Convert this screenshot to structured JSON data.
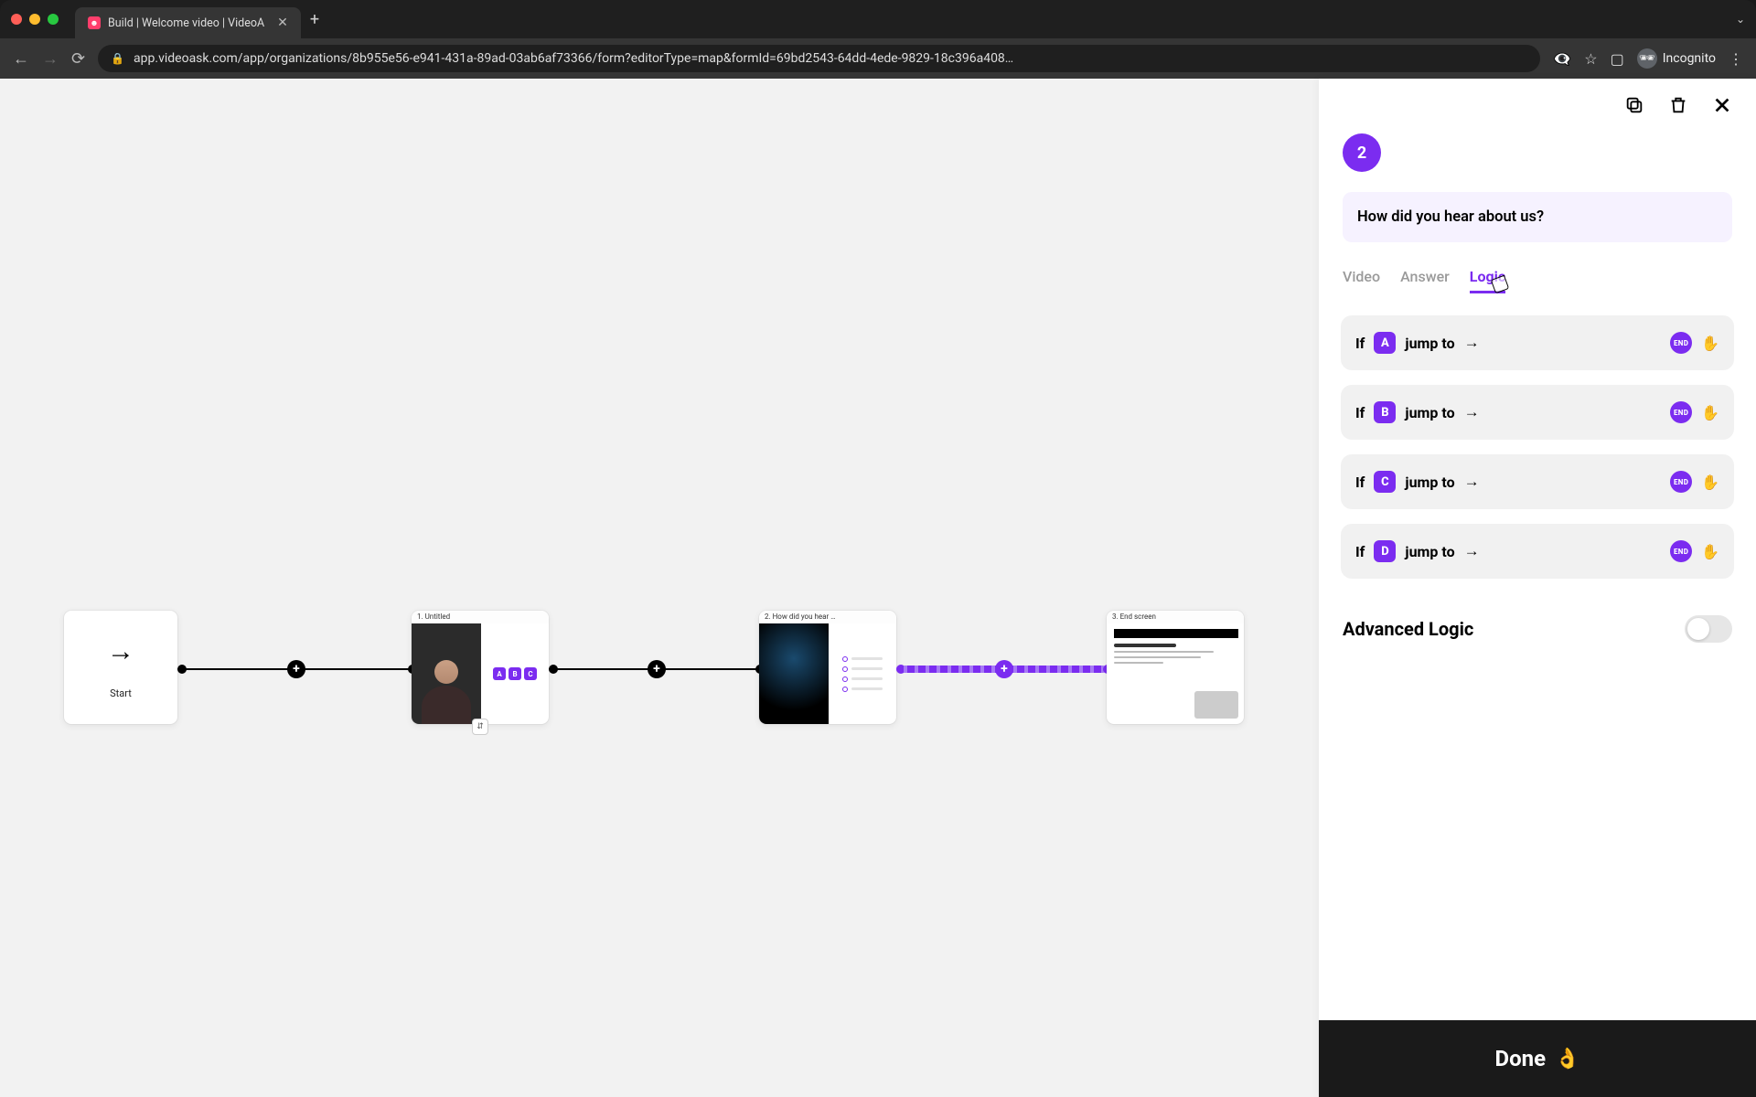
{
  "browser": {
    "tab_title": "Build | Welcome video | VideoA",
    "url": "app.videoask.com/app/organizations/8b955e56-e941-431a-89ad-03ab6af73366/form?editorType=map&formId=69bd2543-64dd-4ede-9829-18c396a408…",
    "incognito_label": "Incognito"
  },
  "canvas": {
    "start_label": "Start",
    "nodes": [
      {
        "index": "1.",
        "title": "Untitled",
        "chips": [
          "A",
          "B",
          "C"
        ]
      },
      {
        "index": "2.",
        "title": "How did you hear …"
      },
      {
        "index": "3.",
        "title": "End screen"
      }
    ]
  },
  "panel": {
    "step_number": "2",
    "question": "How did you hear about us?",
    "tabs": {
      "video": "Video",
      "answer": "Answer",
      "logic": "Logic"
    },
    "rules": [
      {
        "if": "If",
        "letter": "A",
        "jump": "jump to",
        "arrow": "→",
        "end": "END"
      },
      {
        "if": "If",
        "letter": "B",
        "jump": "jump to",
        "arrow": "→",
        "end": "END"
      },
      {
        "if": "If",
        "letter": "C",
        "jump": "jump to",
        "arrow": "→",
        "end": "END"
      },
      {
        "if": "If",
        "letter": "D",
        "jump": "jump to",
        "arrow": "→",
        "end": "END"
      }
    ],
    "advanced_label": "Advanced Logic",
    "done_label": "Done",
    "done_emoji": "👌"
  }
}
